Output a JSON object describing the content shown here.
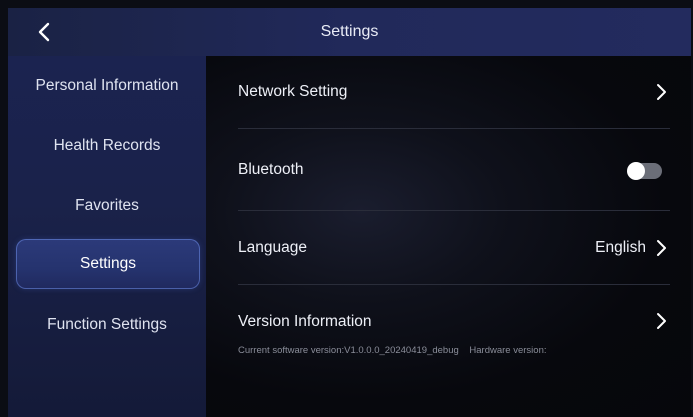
{
  "header": {
    "title": "Settings",
    "back_icon": "chevron-left-icon"
  },
  "sidebar": {
    "items": [
      {
        "label": "Personal Information",
        "active": false
      },
      {
        "label": "Health Records",
        "active": false
      },
      {
        "label": "Favorites",
        "active": false
      },
      {
        "label": "Settings",
        "active": true
      },
      {
        "label": "Function Settings",
        "active": false
      }
    ]
  },
  "main": {
    "network": {
      "label": "Network Setting",
      "icon": "chevron-right-icon"
    },
    "bluetooth": {
      "label": "Bluetooth",
      "enabled": false
    },
    "language": {
      "label": "Language",
      "value": "English",
      "icon": "chevron-right-icon"
    },
    "version": {
      "label": "Version Information",
      "icon": "chevron-right-icon",
      "software": "Current software version:V1.0.0.0_20240419_debug",
      "hardware": "Hardware version:"
    }
  },
  "colors": {
    "header_bg": "#21295a",
    "sidebar_bg": "#1b2350",
    "active_item": "#2c3a7a",
    "main_bg": "#07080d",
    "toggle_off": "#6b6e78"
  }
}
